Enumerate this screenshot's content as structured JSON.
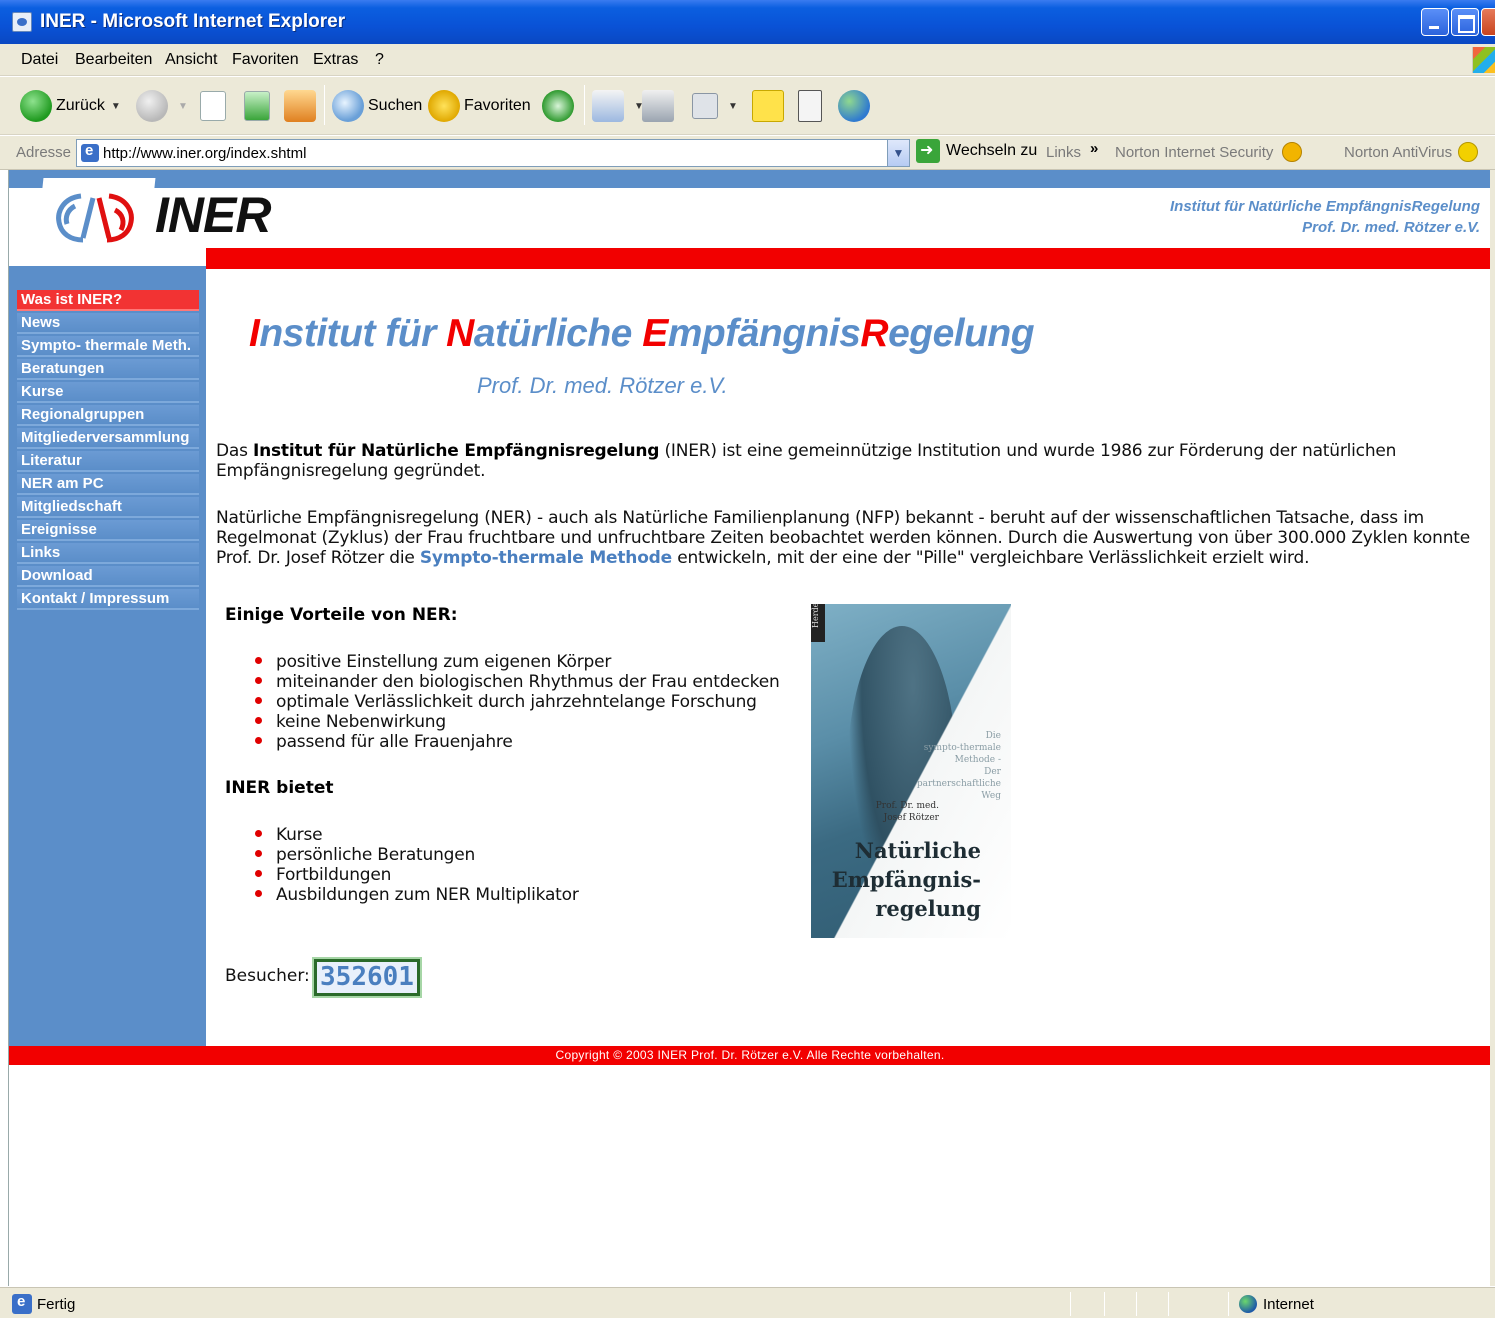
{
  "window": {
    "title": "INER - Microsoft Internet Explorer"
  },
  "menu": [
    "Datei",
    "Bearbeiten",
    "Ansicht",
    "Favoriten",
    "Extras",
    "?"
  ],
  "toolbar": {
    "back": "Zurück",
    "search": "Suchen",
    "favorites": "Favoriten"
  },
  "address": {
    "label": "Adresse",
    "url": "http://www.iner.org/index.shtml",
    "go": "Wechseln zu",
    "links": "Links",
    "links_chevron": "»",
    "norton_security": "Norton Internet Security",
    "norton_antivirus": "Norton AntiVirus"
  },
  "site": {
    "logo": "INER",
    "header_right_1": "Institut für Natürliche EmpfängnisRegelung",
    "header_right_2": "Prof. Dr. med. Rötzer e.V.",
    "nav": [
      "Was ist INER?",
      "News",
      "Sympto- thermale Meth.",
      "Beratungen",
      "Kurse",
      "Regionalgruppen",
      "Mitgliederversammlung",
      "Literatur",
      "NER am PC",
      "Mitgliedschaft",
      "Ereignisse",
      "Links",
      "Download",
      "Kontakt / Impressum"
    ],
    "heading": {
      "I": "I",
      "part1": "nstitut für ",
      "N": "N",
      "part2": "atürliche ",
      "E": "E",
      "part3": "mpfängnis",
      "R": "R",
      "part4": "egelung"
    },
    "subheading": "Prof. Dr. med. Rötzer e.V.",
    "intro": {
      "pre": "Das ",
      "bold": "Institut für Natürliche Empfängnisregelung",
      "post": " (INER) ist eine gemeinnützige Institution und wurde 1986 zur Förderung der natürlichen Empfängnisregelung gegründet."
    },
    "para2": {
      "pre": "Natürliche Empfängnisregelung (NER) - auch als Natürliche Familienplanung (NFP) bekannt - beruht auf der wissenschaftlichen Tatsache, dass im Regelmonat (Zyklus) der Frau fruchtbare und unfruchtbare Zeiten beobachtet werden können. Durch die Auswertung von über 300.000 Zyklen konnte Prof. Dr. Josef Rötzer die ",
      "link": "Sympto-thermale Methode",
      "post": " entwickeln, mit der eine der \"Pille\" vergleichbare Verlässlichkeit erzielt wird."
    },
    "advantages_title": "Einige Vorteile von NER:",
    "advantages": [
      "positive Einstellung zum eigenen Körper",
      "miteinander den biologischen Rhythmus der Frau entdecken",
      "optimale Verlässlichkeit durch jahrzehntelange Forschung",
      "keine Nebenwirkung",
      "passend für alle Frauenjahre"
    ],
    "offers_title": "INER bietet",
    "offers": [
      "Kurse",
      "persönliche Beratungen",
      "Fortbildungen",
      "Ausbildungen zum NER Multiplikator"
    ],
    "book": {
      "spine": "Herder",
      "small": [
        "Die",
        "sympto-thermale",
        "Methode -",
        "Der partnerschaftliche",
        "Weg"
      ],
      "author": [
        "Prof. Dr. med.",
        "Josef Rötzer"
      ],
      "title": [
        "Natürliche",
        "Empfängnis-",
        "regelung"
      ]
    },
    "visitor_label": "Besucher:",
    "visitor_count": "352601",
    "footer": "Copyright © 2003 INER Prof. Dr. Rötzer e.V. Alle Rechte vorbehalten."
  },
  "status": {
    "text": "Fertig",
    "zone": "Internet"
  },
  "colors": {
    "accent_blue": "#5b8ec9",
    "accent_red": "#f20000"
  }
}
